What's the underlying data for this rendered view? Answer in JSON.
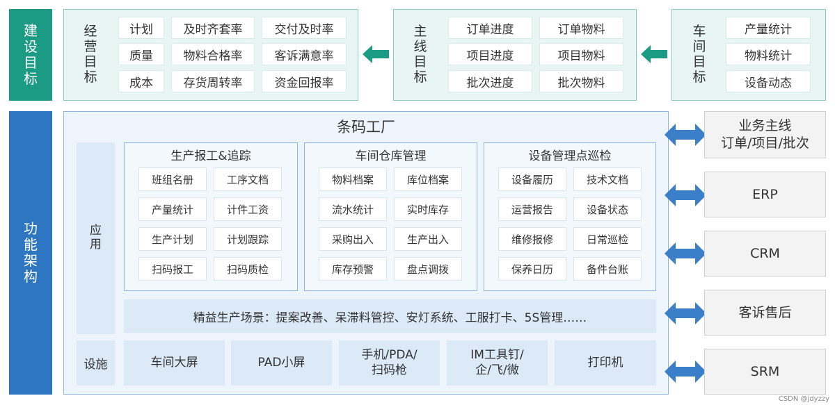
{
  "categories": {
    "build_goals": [
      "建",
      "设",
      "目",
      "标"
    ],
    "function_arch": [
      "功",
      "能",
      "架",
      "构"
    ]
  },
  "goals": {
    "business": {
      "label": [
        "经",
        "营",
        "目",
        "标"
      ],
      "cells": [
        "计划",
        "及时齐套率",
        "交付及时率",
        "质量",
        "物料合格率",
        "客诉满意率",
        "成本",
        "存货周转率",
        "资金回报率"
      ]
    },
    "mainline": {
      "label": [
        "主",
        "线",
        "目",
        "标"
      ],
      "cells": [
        "订单进度",
        "订单物料",
        "项目进度",
        "项目物料",
        "批次进度",
        "批次物料"
      ]
    },
    "workshop": {
      "label": [
        "车",
        "间",
        "目",
        "标"
      ],
      "cells": [
        "产量统计",
        "物料统计",
        "设备动态"
      ]
    }
  },
  "main": {
    "title": "条码工厂",
    "app_label": [
      "应",
      "用"
    ],
    "facility_label": "设施",
    "modules": [
      {
        "title": "生产报工&追踪",
        "cells": [
          "班组名册",
          "工序文档",
          "产量统计",
          "计件工资",
          "生产计划",
          "计划跟踪",
          "扫码报工",
          "扫码质检"
        ]
      },
      {
        "title": "车间仓库管理",
        "cells": [
          "物料档案",
          "库位档案",
          "流水统计",
          "实时库存",
          "采购出入",
          "生产出入",
          "库存预警",
          "盘点调拨"
        ]
      },
      {
        "title": "设备管理点巡检",
        "cells": [
          "设备履历",
          "技术文档",
          "运营报告",
          "设备状态",
          "维修报修",
          "日常巡检",
          "保养日历",
          "备件台账"
        ]
      }
    ],
    "scene": "精益生产场景：提案改善、呆滞料管控、安灯系统、工服打卡、5S管理……",
    "facilities": [
      [
        "车间大屏"
      ],
      [
        "PAD小屏"
      ],
      [
        "手机/PDA/",
        "扫码枪"
      ],
      [
        "IM工具钉/",
        "企/飞/微"
      ],
      [
        "打印机"
      ]
    ]
  },
  "systems": [
    [
      "业务主线",
      "订单/项目/批次"
    ],
    [
      "ERP"
    ],
    [
      "CRM"
    ],
    [
      "客诉售后"
    ],
    [
      "SRM"
    ]
  ],
  "colors": {
    "green": "#1b9a84",
    "blue": "#2e76c1",
    "arrow_blue": "#3a7fc8"
  },
  "watermark": "CSDN @jdyzzy"
}
